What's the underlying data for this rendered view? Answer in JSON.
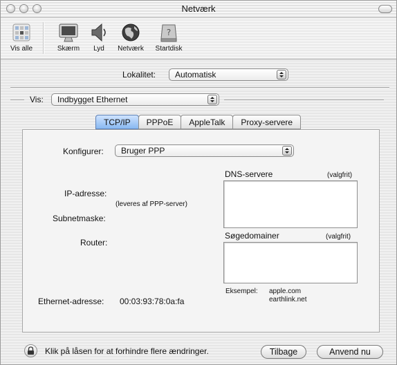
{
  "window": {
    "title": "Netværk"
  },
  "toolbar": {
    "items": [
      {
        "label": "Vis alle",
        "icon": "show-all-icon"
      },
      {
        "label": "Skærm",
        "icon": "display-icon"
      },
      {
        "label": "Lyd",
        "icon": "sound-icon"
      },
      {
        "label": "Netværk",
        "icon": "network-globe-icon"
      },
      {
        "label": "Startdisk",
        "icon": "startup-disk-icon"
      }
    ]
  },
  "location": {
    "label": "Lokalitet:",
    "value": "Automatisk"
  },
  "show": {
    "label": "Vis:",
    "value": "Indbygget Ethernet"
  },
  "tabs": [
    {
      "label": "TCP/IP",
      "active": true
    },
    {
      "label": "PPPoE",
      "active": false
    },
    {
      "label": "AppleTalk",
      "active": false
    },
    {
      "label": "Proxy-servere",
      "active": false
    }
  ],
  "tcpip": {
    "configure_label": "Konfigurer:",
    "configure_value": "Bruger PPP",
    "ip_label": "IP-adresse:",
    "ip_note": "(leveres af PPP-server)",
    "subnet_label": "Subnetmaske:",
    "router_label": "Router:",
    "dns_label": "DNS-servere",
    "dns_optional": "(valgfrit)",
    "search_label": "Søgedomainer",
    "search_optional": "(valgfrit)",
    "example_label": "Eksempel:",
    "example_1": "apple.com",
    "example_2": "earthlink.net",
    "ethernet_label": "Ethernet-adresse:",
    "ethernet_value": "00:03:93:78:0a:fa"
  },
  "footer": {
    "lock_text": "Klik på låsen for at forhindre flere ændringer.",
    "back_button": "Tilbage",
    "apply_button": "Anvend nu"
  },
  "colors": {
    "active_tab": "#88b8f1",
    "window_bg": "#eeeeee"
  }
}
